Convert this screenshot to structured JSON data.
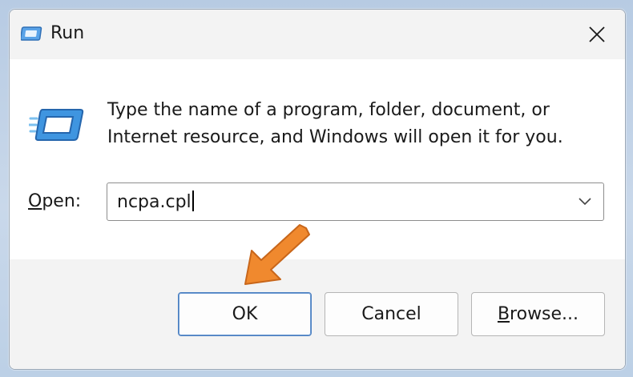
{
  "window": {
    "title": "Run",
    "close_icon": "close-icon",
    "title_icon": "run-icon"
  },
  "content": {
    "description": "Type the name of a program, folder, document, or Internet resource, and Windows will open it for you.",
    "open_label_mnemonic": "O",
    "open_label_rest": "pen:",
    "open_value": "ncpa.cpl",
    "dropdown_icon": "chevron-down-icon"
  },
  "buttons": {
    "ok_label": "OK",
    "cancel_label": "Cancel",
    "browse_mnemonic": "B",
    "browse_rest": "rowse..."
  },
  "annotation": {
    "pointer": "orange-arrow-pointing-at-ok",
    "color": "#f0892e"
  },
  "colors": {
    "titlebar": "#f3f3f3",
    "footer": "#f3f3f3",
    "accent": "#4a7fc1"
  }
}
